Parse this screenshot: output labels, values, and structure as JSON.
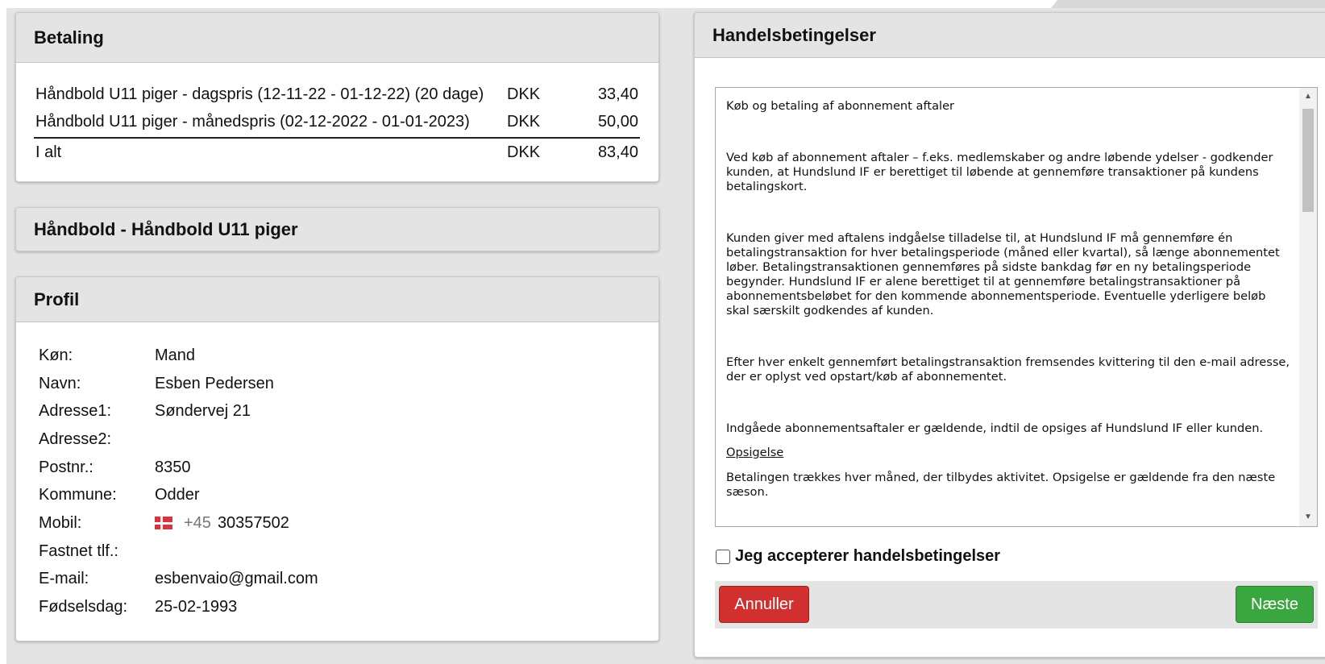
{
  "colors": {
    "page_bg": "#e4e4e4",
    "panel_header_bg": "#e4e4e4",
    "cancel_button": "#d22f2f",
    "next_button": "#3aa63f"
  },
  "payment": {
    "title": "Betaling",
    "rows": [
      {
        "desc": "Håndbold U11 piger - dagspris (12-11-22 - 01-12-22) (20 dage)",
        "currency": "DKK",
        "amount": "33,40"
      },
      {
        "desc": "Håndbold U11 piger - månedspris (02-12-2022 - 01-01-2023)",
        "currency": "DKK",
        "amount": "50,00"
      }
    ],
    "total": {
      "label": "I alt",
      "currency": "DKK",
      "amount": "83,40"
    }
  },
  "activity": {
    "title": "Håndbold - Håndbold U11 piger"
  },
  "profile": {
    "title": "Profil",
    "fields": [
      {
        "label": "Køn:",
        "value": "Mand"
      },
      {
        "label": "Navn:",
        "value": "Esben Pedersen"
      },
      {
        "label": "Adresse1:",
        "value": "Søndervej 21"
      },
      {
        "label": "Adresse2:",
        "value": ""
      },
      {
        "label": "Postnr.:",
        "value": "8350"
      },
      {
        "label": "Kommune:",
        "value": "Odder"
      },
      {
        "label": "Mobil:",
        "prefix": "+45",
        "value": "30357502",
        "flag_icon": "denmark-flag-icon"
      },
      {
        "label": "Fastnet tlf.:",
        "value": ""
      },
      {
        "label": "E-mail:",
        "value": "esbenvaio@gmail.com"
      },
      {
        "label": "Fødselsdag:",
        "value": "25-02-1993"
      }
    ]
  },
  "terms": {
    "title": "Handelsbetingelser",
    "paragraphs": [
      "Køb og betaling af abonnement aftaler",
      "Ved køb af abonnement aftaler – f.eks. medlemskaber og andre løbende ydelser - godkender kunden, at Hundslund IF er berettiget til løbende at gennemføre transaktioner på kundens betalingskort.",
      "Kunden giver med aftalens indgåelse tilladelse til, at Hundslund IF må gennemføre én betalingstransaktion for hver betalingsperiode (måned eller kvartal), så længe abonnementet løber. Betalingstransaktionen gennemføres på sidste bankdag før en ny betalingsperiode begynder. Hundslund IF er alene berettiget til at gennemføre betalingstransaktioner på abonnementsbeløbet for den kommende abonnementsperiode. Eventuelle yderligere beløb skal særskilt godkendes af kunden.",
      "Efter hver enkelt gennemført betalingstransaktion fremsendes kvittering til den e-mail adresse, der er oplyst ved opstart/køb af abonnementet.",
      "Indgåede abonnementsaftaler er gældende, indtil de opsiges af Hundslund IF eller kunden.",
      "Opsigelse",
      "Betalingen trækkes hver måned, der tilbydes aktivitet. Opsigelse er gældende fra den næste sæson."
    ],
    "accept_label": "Jeg accepterer handelsbetingelser",
    "accept_checked": false,
    "cancel_label": "Annuller",
    "next_label": "Næste"
  }
}
